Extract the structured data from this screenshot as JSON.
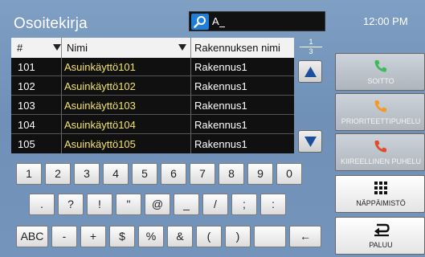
{
  "header": {
    "title": "Osoitekirja",
    "search_value": "A",
    "clock": "12:00 PM"
  },
  "table": {
    "columns": [
      "#",
      "Nimi",
      "Rakennuksen nimi"
    ],
    "rows": [
      {
        "num": "101",
        "name": "Asuinkäyttö101",
        "building": "Rakennus1"
      },
      {
        "num": "102",
        "name": "Asuinkäyttö102",
        "building": "Rakennus1"
      },
      {
        "num": "103",
        "name": "Asuinkäyttö103",
        "building": "Rakennus1"
      },
      {
        "num": "104",
        "name": "Asuinkäyttö104",
        "building": "Rakennus1"
      },
      {
        "num": "105",
        "name": "Asuinkäyttö105",
        "building": "Rakennus1"
      }
    ],
    "page_current": "1",
    "page_total": "3"
  },
  "keyboard": {
    "row1": [
      "1",
      "2",
      "3",
      "4",
      "5",
      "6",
      "7",
      "8",
      "9",
      "0"
    ],
    "row2": [
      ".",
      "?",
      "!",
      "\"",
      "@",
      "_",
      "/",
      ";",
      ":"
    ],
    "row3": [
      "ABC",
      "-",
      "+",
      "$",
      "%",
      "&",
      "(",
      ")",
      "",
      "←"
    ]
  },
  "side": {
    "call": "SOITTO",
    "priority_call": "PRIORITEETTIPUHELU",
    "urgent_call": "KIIREELLINEN PUHELU",
    "keypad": "NÄPPÄIMISTÖ",
    "back": "PALUU"
  },
  "colors": {
    "background": "#7a9bc1",
    "name_text": "#f6e36a",
    "call_icon": "#3dbb5a",
    "priority_icon": "#f39a24",
    "urgent_icon": "#e24a2a",
    "search_button": "#1f7ed6"
  },
  "icons": {
    "search": "magnifier-icon",
    "call": "phone-icon",
    "keypad": "keypad-grid-icon",
    "back": "return-arrow-icon",
    "scroll_up": "triangle-up-icon",
    "scroll_down": "triangle-down-icon"
  }
}
